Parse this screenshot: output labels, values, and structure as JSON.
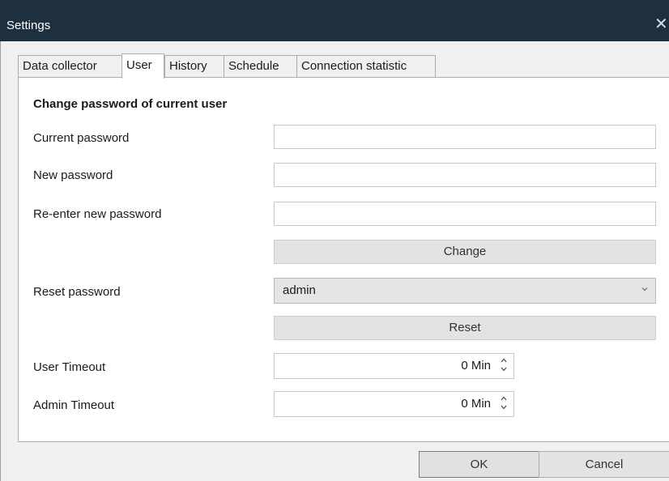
{
  "window": {
    "title": "Settings",
    "close_glyph": "✕"
  },
  "tabs": [
    {
      "label": "Data collector"
    },
    {
      "label": "User"
    },
    {
      "label": "History"
    },
    {
      "label": "Schedule"
    },
    {
      "label": "Connection statistic"
    }
  ],
  "active_tab": "User",
  "user": {
    "section_title": "Change password of current user",
    "current_password_label": "Current password",
    "current_password_value": "",
    "new_password_label": "New password",
    "new_password_value": "",
    "reenter_label": "Re-enter new password",
    "reenter_value": "",
    "change_button": "Change",
    "reset_password_label": "Reset password",
    "reset_user_selected": "admin",
    "reset_button": "Reset",
    "user_timeout_label": "User Timeout",
    "user_timeout_value": "0 Min",
    "admin_timeout_label": "Admin Timeout",
    "admin_timeout_value": "0 Min"
  },
  "footer": {
    "ok_label": "OK",
    "cancel_label": "Cancel"
  },
  "icons": {
    "close": "close-icon",
    "dropdown": "chevron-down-icon",
    "spin_up": "spin-up-icon",
    "spin_down": "spin-down-icon"
  },
  "colors": {
    "titlebar": "#1e2f3e",
    "panel": "#ffffff",
    "background": "#f0f0f0"
  }
}
